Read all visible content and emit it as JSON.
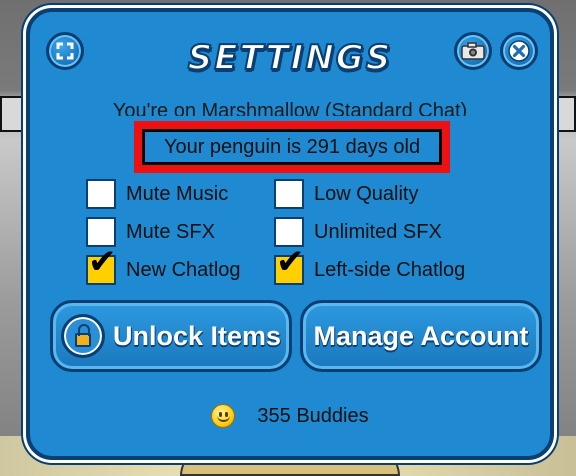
{
  "dialog": {
    "title": "SETTINGS",
    "server_status": "You're on Marshmallow (Standard Chat)",
    "penguin_age": "Your penguin is 291 days old"
  },
  "header_buttons": [
    {
      "name": "fullscreen",
      "icon": "fullscreen-icon"
    },
    {
      "name": "camera",
      "icon": "camera-icon"
    },
    {
      "name": "close",
      "icon": "close-icon"
    }
  ],
  "options": [
    {
      "label": "Mute Music",
      "checked": false
    },
    {
      "label": "Low Quality",
      "checked": false
    },
    {
      "label": "Mute SFX",
      "checked": false
    },
    {
      "label": "Unlimited SFX",
      "checked": false
    },
    {
      "label": "New Chatlog",
      "checked": true
    },
    {
      "label": "Left-side Chatlog",
      "checked": true
    }
  ],
  "actions": {
    "unlock_items": "Unlock Items",
    "manage_account": "Manage Account"
  },
  "buddies": {
    "icon": "smiley-icon",
    "text": "355 Buddies"
  },
  "colors": {
    "panel_blue": "#1f8ad1",
    "panel_border": "#0a3f73",
    "highlight_red": "#ee1111",
    "checked_yellow": "#ffcf00"
  }
}
